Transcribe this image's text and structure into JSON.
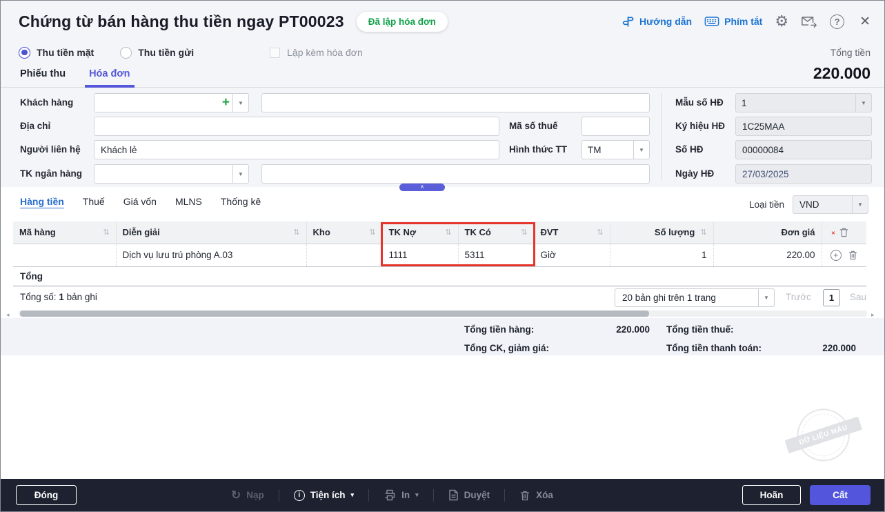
{
  "window": {
    "title": "Chứng từ bán hàng thu tiền ngay PT00023",
    "status_badge": "Đã lập hóa đơn"
  },
  "header": {
    "guide": "Hướng dẫn",
    "shortcuts": "Phím tắt"
  },
  "payment_options": {
    "cash": "Thu tiền mặt",
    "bank": "Thu tiền gửi",
    "with_invoice": "Lập kèm hóa đơn"
  },
  "total": {
    "label": "Tổng tiền",
    "value": "220.000"
  },
  "tabs": {
    "receipt": "Phiếu thu",
    "invoice": "Hóa đơn"
  },
  "form": {
    "customer": {
      "label": "Khách hàng",
      "value": "",
      "name": ""
    },
    "address": {
      "label": "Địa chỉ",
      "value": ""
    },
    "tax_code": {
      "label": "Mã số thuế",
      "value": ""
    },
    "contact": {
      "label": "Người liên hệ",
      "value": "Khách lẻ"
    },
    "payment_method": {
      "label": "Hình thức TT",
      "value": "TM"
    },
    "bank_account": {
      "label": "TK ngân hàng",
      "value": "",
      "detail": ""
    },
    "invoice_template": {
      "label": "Mẫu số HĐ",
      "value": "1"
    },
    "invoice_series": {
      "label": "Ký hiệu HĐ",
      "value": "1C25MAA"
    },
    "invoice_number": {
      "label": "Số HĐ",
      "value": "00000084"
    },
    "invoice_date": {
      "label": "Ngày HĐ",
      "value": "27/03/2025"
    }
  },
  "detail_tabs": [
    "Hàng tiền",
    "Thuế",
    "Giá vốn",
    "MLNS",
    "Thống kê"
  ],
  "currency": {
    "label": "Loại tiền",
    "value": "VND"
  },
  "table": {
    "headers": [
      "Mã hàng",
      "Diễn giải",
      "Kho",
      "TK Nợ",
      "TK Có",
      "ĐVT",
      "Số lượng",
      "Đơn giá"
    ],
    "rows": [
      {
        "ma_hang": "",
        "dien_giai": "Dịch vụ lưu trú phòng A.03",
        "kho": "",
        "tk_no": "1111",
        "tk_co": "5311",
        "dvt": "Giờ",
        "so_luong": "1",
        "don_gia": "220.00"
      }
    ],
    "total_row_label": "Tổng"
  },
  "pagination": {
    "summary_prefix": "Tổng số:",
    "count": "1",
    "summary_suffix": "bản ghi",
    "page_size": "20 bản ghi trên 1 trang",
    "prev": "Trước",
    "page": "1",
    "next": "Sau"
  },
  "summary": {
    "goods": {
      "label": "Tổng tiền hàng:",
      "value": "220.000"
    },
    "tax": {
      "label": "Tổng tiền thuế:",
      "value": ""
    },
    "discount": {
      "label": "Tổng CK, giảm giá:",
      "value": ""
    },
    "payment": {
      "label": "Tổng tiền thanh toán:",
      "value": "220.000"
    }
  },
  "watermark": "DỮ LIỆU MẪU",
  "footer": {
    "close": "Đóng",
    "reload": "Nạp",
    "utilities": "Tiện ích",
    "print": "In",
    "approve": "Duyệt",
    "delete": "Xóa",
    "postpone": "Hoãn",
    "save": "Cất"
  },
  "icons": {
    "gear": "⚙",
    "close": "✕",
    "help": "?",
    "caret_down": "▼",
    "caret_small": "▾",
    "sort": "⇅",
    "plus": "+",
    "circle_plus": "+",
    "refresh": "↻",
    "chevron_up": "∧",
    "prev": "◂",
    "next": "▸",
    "info": "i"
  },
  "colors": {
    "accent": "#5356dd",
    "link": "#1b74d2",
    "badge_green": "#12a24b",
    "highlight_red": "#e5342c",
    "footer_bg": "#1e2230"
  }
}
